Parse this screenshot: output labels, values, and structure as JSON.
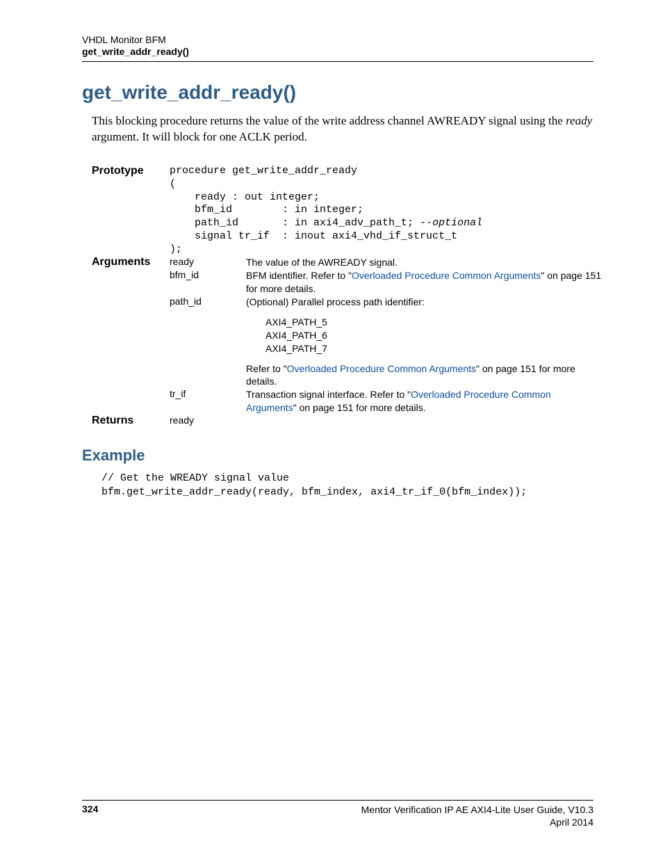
{
  "header": {
    "line1": "VHDL Monitor BFM",
    "line2": "get_write_addr_ready()"
  },
  "title": "get_write_addr_ready()",
  "intro": {
    "pre": "This blocking procedure returns the value of the write address channel AWREADY signal using the ",
    "em": "ready",
    "post": " argument. It will block for one ACLK period."
  },
  "labels": {
    "prototype": "Prototype",
    "arguments": "Arguments",
    "returns": "Returns",
    "example": "Example"
  },
  "prototype": {
    "l1": "procedure get_write_addr_ready",
    "l2": "(",
    "l3": "    ready : out integer;",
    "l4": "    bfm_id        : in integer;",
    "l5a": "    path_id       : in axi4_adv_path_t; ",
    "l5b": "--optional",
    "l6": "    signal tr_if  : inout axi4_vhd_if_struct_t",
    "l7": ");"
  },
  "args": {
    "ready": {
      "name": "ready",
      "desc": "The value of the AWREADY signal."
    },
    "bfm_id": {
      "name": "bfm_id",
      "pre": "BFM identifier. Refer to \"",
      "link": "Overloaded Procedure Common Arguments",
      "post": "\" on page 151 for more details."
    },
    "path_id": {
      "name": "path_id",
      "intro": "(Optional) Parallel process path identifier:",
      "p1": "AXI4_PATH_5",
      "p2": "AXI4_PATH_6",
      "p3": "AXI4_PATH_7",
      "pre": "Refer to \"",
      "link": "Overloaded Procedure Common Arguments",
      "post": "\" on page 151 for more details."
    },
    "tr_if": {
      "name": "tr_if",
      "pre": "Transaction signal interface. Refer to \"",
      "link": "Overloaded Procedure Common Arguments",
      "post": "\" on page 151 for more details."
    }
  },
  "returns": {
    "value": "ready"
  },
  "example_code": {
    "l1": "// Get the WREADY signal value",
    "l2": "bfm.get_write_addr_ready(ready, bfm_index, axi4_tr_if_0(bfm_index));"
  },
  "footer": {
    "page": "324",
    "right1": "Mentor Verification IP AE AXI4-Lite User Guide, V10.3",
    "right2": "April 2014"
  }
}
